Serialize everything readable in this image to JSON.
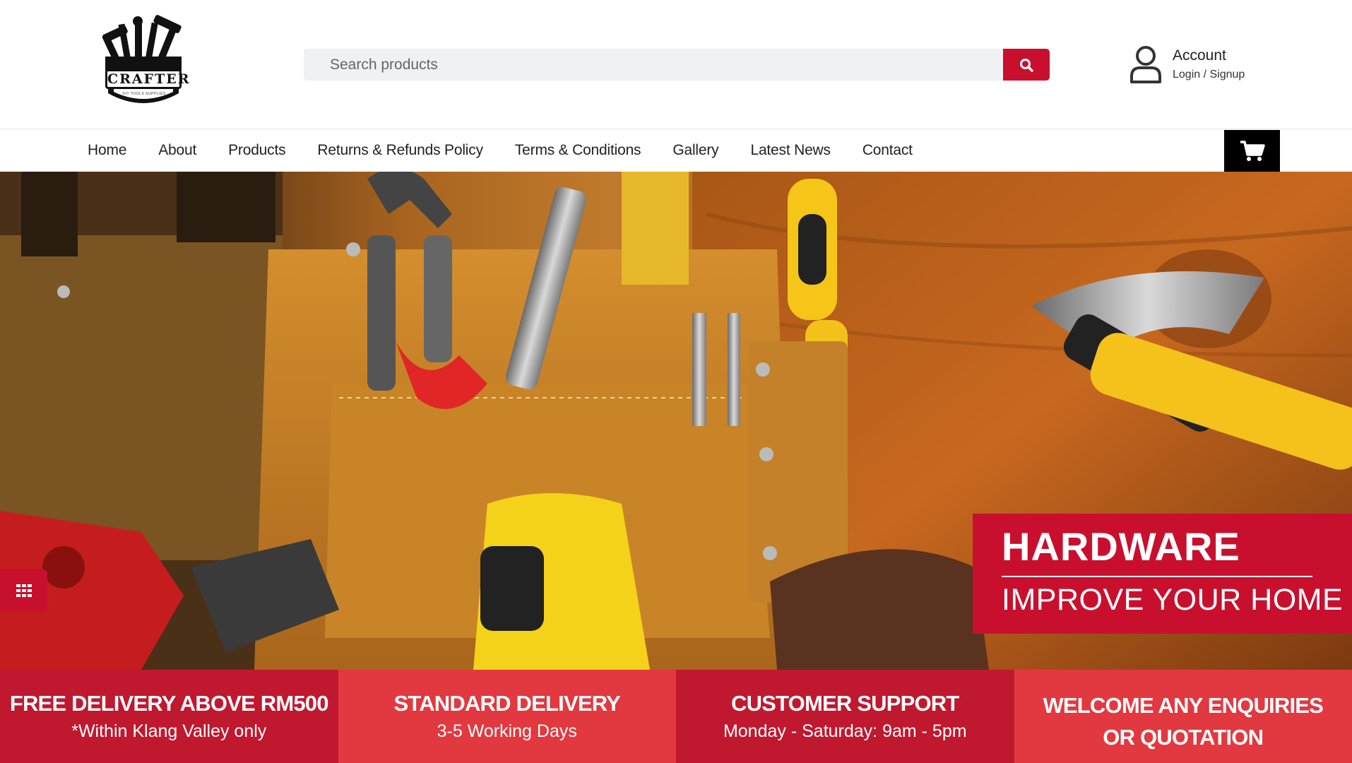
{
  "header": {
    "logo": {
      "text": "CRAFTER",
      "subtext": "DIY TOOLS SUPPLIES"
    },
    "search": {
      "placeholder": "Search products",
      "button_icon": "search-icon"
    },
    "account": {
      "title": "Account",
      "subtitle": "Login / Signup",
      "icon": "user-icon"
    }
  },
  "nav": {
    "items": [
      {
        "label": "Home"
      },
      {
        "label": "About"
      },
      {
        "label": "Products"
      },
      {
        "label": "Returns & Refunds Policy"
      },
      {
        "label": "Terms & Conditions"
      },
      {
        "label": "Gallery"
      },
      {
        "label": "Latest News"
      },
      {
        "label": "Contact"
      }
    ],
    "cart_icon": "shopping-cart-icon"
  },
  "hero": {
    "banner_title": "HARDWARE",
    "banner_subtitle": "IMPROVE YOUR HOME",
    "side_toggle_icon": "grid-icon"
  },
  "features": [
    {
      "title": "FREE DELIVERY ABOVE RM500",
      "subtitle": "*Within Klang Valley only"
    },
    {
      "title": "STANDARD DELIVERY",
      "subtitle": "3-5 Working Days"
    },
    {
      "title": "CUSTOMER SUPPORT",
      "subtitle": "Monday - Saturday: 9am - 5pm"
    },
    {
      "title": "WELCOME ANY ENQUIRIES OR QUOTATION",
      "subtitle": ""
    }
  ],
  "colors": {
    "brand_red": "#c8102e",
    "feature_dark": "#c0182e",
    "feature_light": "#e2383f",
    "cart_bg": "#000000",
    "search_bg": "#f0f1f4"
  }
}
